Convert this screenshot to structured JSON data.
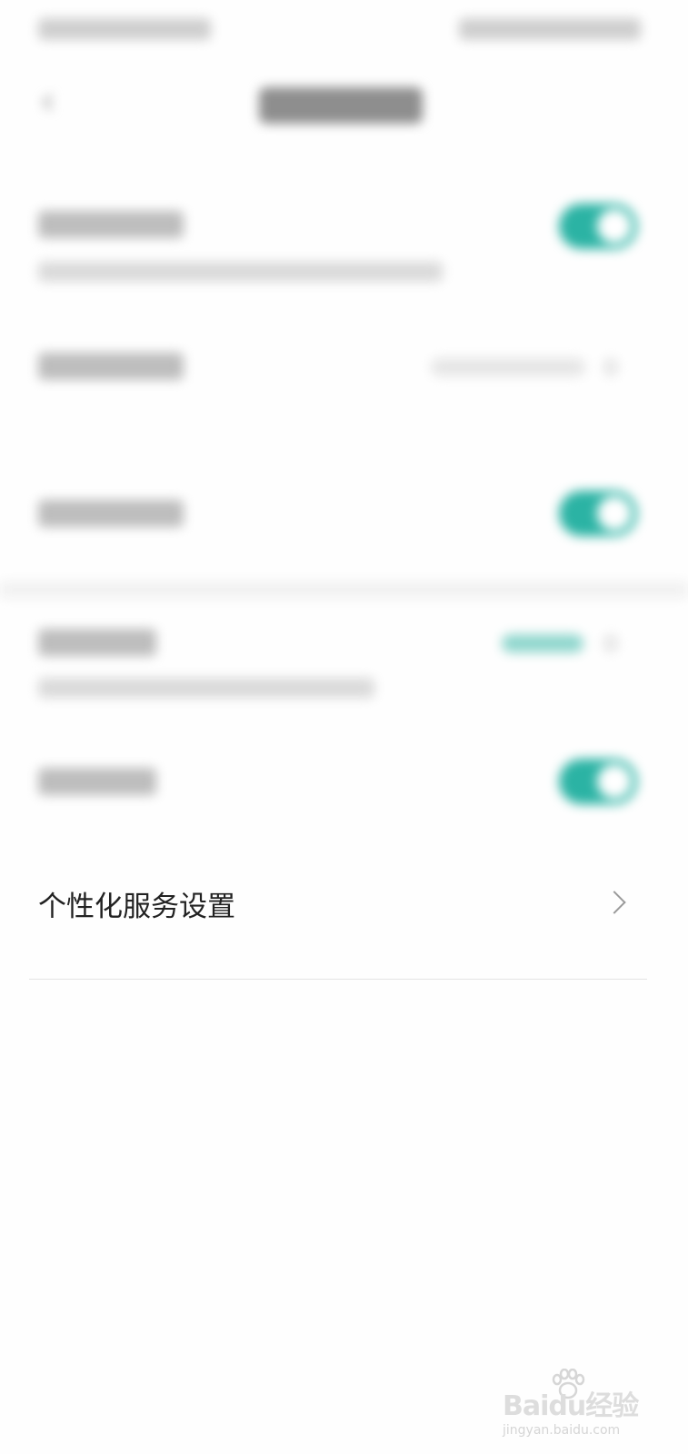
{
  "settings": {
    "personalized_service": {
      "label": "个性化服务设置"
    }
  },
  "watermark": {
    "brand": "Baidu经验",
    "site": "jingyan.baidu.com"
  },
  "colors": {
    "toggle_on": "#2bb3a4",
    "background": "#fefefe",
    "divider": "#e3e3e3"
  },
  "icons": {
    "back": "chevron-left-icon",
    "row_arrow": "chevron-right-icon",
    "watermark_logo": "paw-icon"
  }
}
